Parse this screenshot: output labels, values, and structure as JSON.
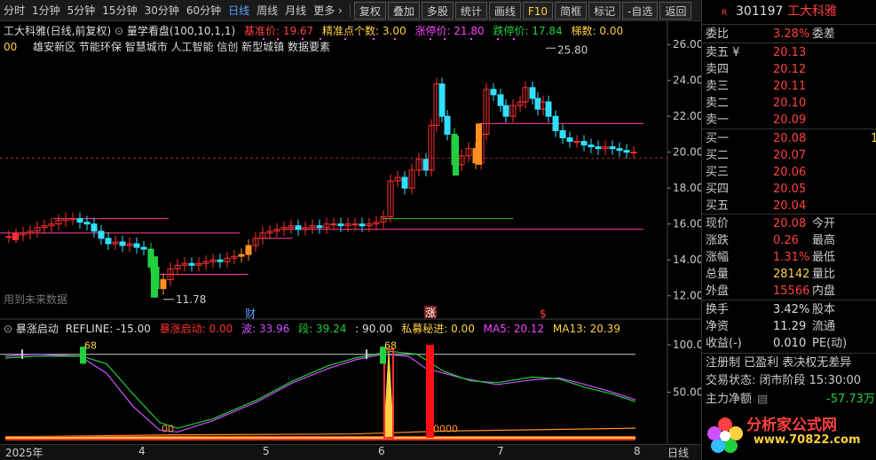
{
  "toolbar": {
    "items": [
      "分时",
      "1分钟",
      "5分钟",
      "15分钟",
      "30分钟",
      "60分钟",
      "日线",
      "周线",
      "月线",
      "更多 ›"
    ],
    "right_items": [
      "复权",
      "叠加",
      "多股",
      "统计",
      "画线",
      "F10",
      "简框",
      "标记",
      "-自选",
      "返回"
    ]
  },
  "chart": {
    "title": "工大科雅(日线,前复权)",
    "indicator_name": "量学看盘(100,10,1,1)",
    "jz_label": "基准价: 19.67",
    "jz_point_label": "精准点个数: 3.00",
    "zt_label": "涨停价: 21.80",
    "dt_label": "跌停价: 17.84",
    "ts_label": "梯数: 0.00",
    "concept_prefix": "00",
    "concepts": "雄安新区  节能环保  智慧城市  人工智能  信创  新型城镇  数据要素",
    "high_label": "25.80",
    "low_label": "11.78",
    "watermark": "用到未来数据",
    "y_ticks": [
      "26.00",
      "24.00",
      "22.00",
      "20.00",
      "18.00",
      "16.00",
      "14.00",
      "12.00"
    ],
    "markers": [
      "财",
      "涨",
      "$"
    ]
  },
  "indicator": {
    "name": "暴涨启动",
    "refline": "REFLINE: -15.00",
    "qd": "暴涨启动: 0.00",
    "bo": "波: 33.96",
    "duan": "段: 39.24",
    "ninety": ": 90.00",
    "smy": "私募秘进: 0.00",
    "ma5": "MA5: 20.12",
    "ma13": "MA13: 20.39",
    "y_ticks": [
      "100.0",
      "50.00"
    ],
    "labels": [
      "68",
      "68",
      "00",
      "0000"
    ]
  },
  "x_axis": {
    "labels": [
      "2025年",
      "4",
      "5",
      "6",
      "7",
      "8"
    ],
    "period": "日线"
  },
  "quote": {
    "code": "301197",
    "name": "工大科雅",
    "wb_label": "委比",
    "wb_value": "3.28%",
    "wc_label": "委差",
    "asks": [
      {
        "label": "卖五 ¥",
        "price": "20.13"
      },
      {
        "label": "卖四",
        "price": "20.12"
      },
      {
        "label": "卖三",
        "price": "20.11"
      },
      {
        "label": "卖二",
        "price": "20.10"
      },
      {
        "label": "卖一",
        "price": "20.09"
      }
    ],
    "bids": [
      {
        "label": "买一",
        "price": "20.08",
        "vol": "1"
      },
      {
        "label": "买二",
        "price": "20.07"
      },
      {
        "label": "买三",
        "price": "20.06"
      },
      {
        "label": "买四",
        "price": "20.05"
      },
      {
        "label": "买五",
        "price": "20.04"
      }
    ],
    "stats": [
      {
        "label": "现价",
        "value": "20.08",
        "label2": "今开",
        "color": "red"
      },
      {
        "label": "涨跌",
        "value": "0.26",
        "label2": "最高",
        "color": "red"
      },
      {
        "label": "涨幅",
        "value": "1.31%",
        "label2": "最低",
        "color": "red"
      },
      {
        "label": "总量",
        "value": "28142",
        "label2": "量比",
        "color": "yellow"
      },
      {
        "label": "外盘",
        "value": "15566",
        "label2": "内盘",
        "color": "red"
      }
    ],
    "stats2": [
      {
        "label": "换手",
        "value": "3.42%",
        "label2": "股本"
      },
      {
        "label": "净资",
        "value": "11.29",
        "label2": "流通"
      },
      {
        "label": "收益(-)",
        "value": "0.010",
        "label2": "PE(动)"
      }
    ],
    "tags": "注册制  已盈利  表决权无差异",
    "trade_status": "交易状态: 闭市阶段 15:30:00",
    "main_net_label": "主力净额",
    "main_net_value": "-57.73万",
    "ad_text": "分析家公式网",
    "ad_url": "www.70822.com"
  },
  "colors": {
    "up": "#ff3030",
    "down": "#30e0ff",
    "accent": "#5aa2ff"
  }
}
